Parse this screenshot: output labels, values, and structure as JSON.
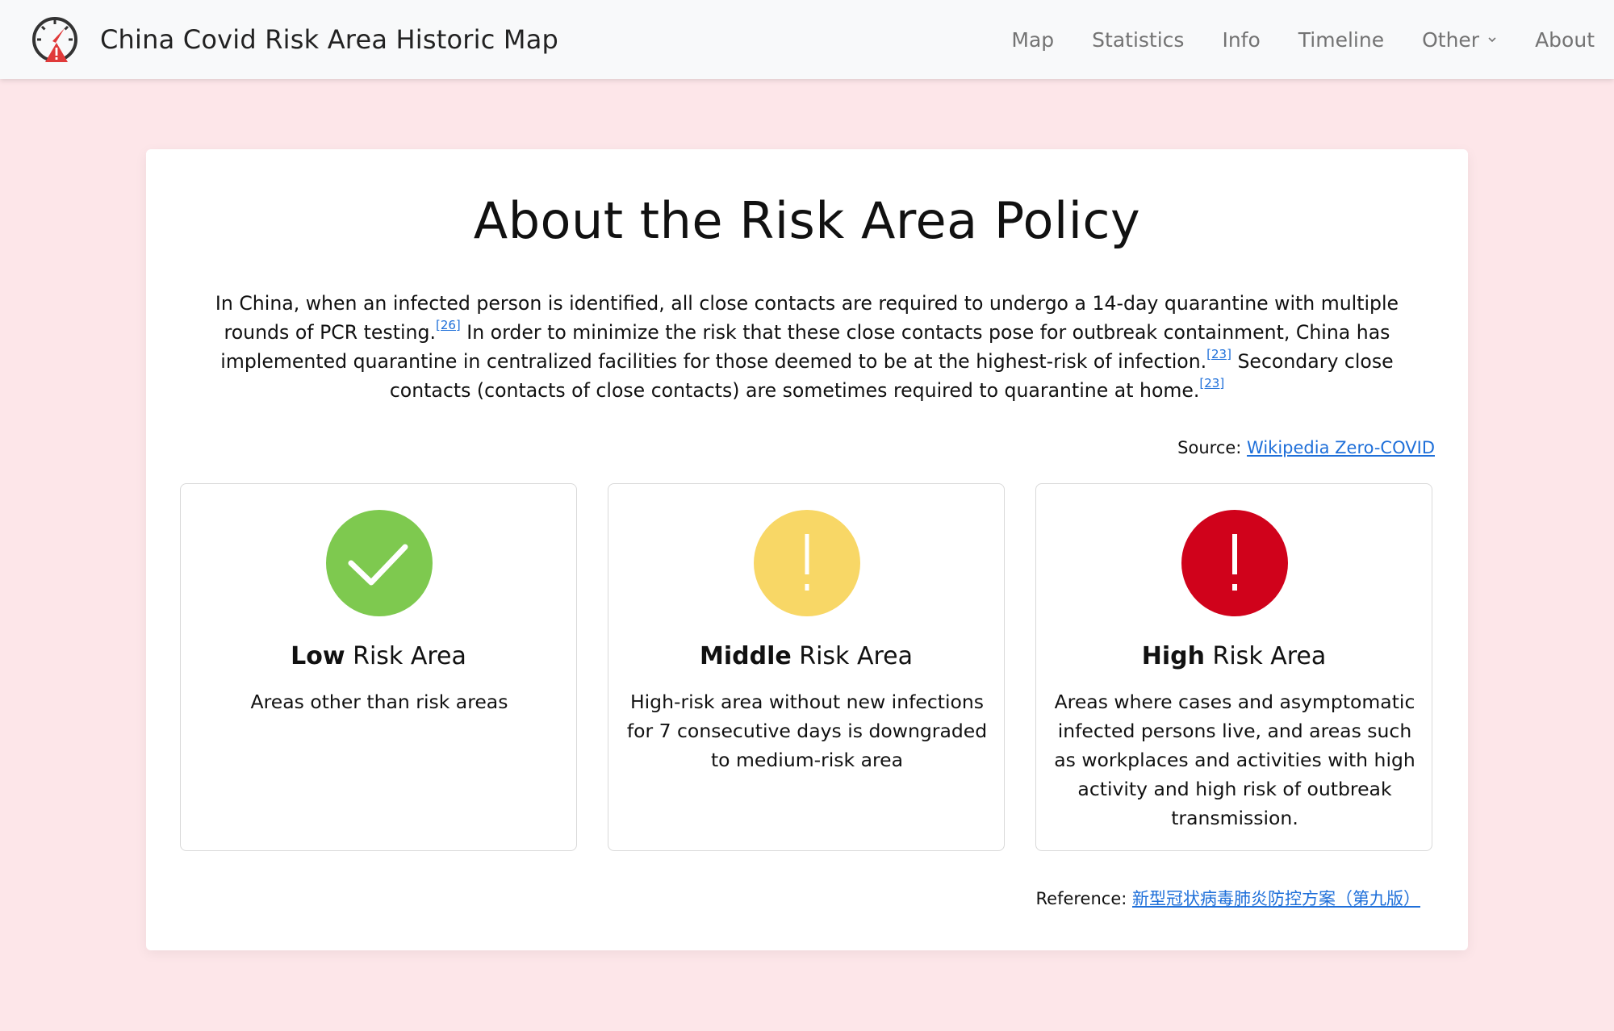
{
  "navbar": {
    "brand_title": "China Covid Risk Area Historic Map",
    "links": [
      {
        "label": "Map"
      },
      {
        "label": "Statistics"
      },
      {
        "label": "Info"
      },
      {
        "label": "Timeline"
      },
      {
        "label": "Other",
        "dropdown": true
      },
      {
        "label": "About"
      }
    ]
  },
  "main": {
    "title": "About the Risk Area Policy",
    "intro": {
      "part1": "In China, when an infected person is identified, all close contacts are required to undergo a 14-day quarantine with multiple rounds of PCR testing.",
      "cite1": "[26]",
      "part2": " In order to minimize the risk that these close contacts pose for outbreak containment, China has implemented quarantine in centralized facilities for those deemed to be at the highest-risk of infection.",
      "cite2": "[23]",
      "part3": " Secondary close contacts (contacts of close contacts) are sometimes required to quarantine at home.",
      "cite3": "[23]"
    },
    "source": {
      "label": "Source: ",
      "link_text": "Wikipedia Zero-COVID"
    },
    "tiles": [
      {
        "level": "Low",
        "suffix": " Risk Area",
        "description": "Areas other than risk areas",
        "icon": "check-icon",
        "color": "#7ec94f"
      },
      {
        "level": "Middle",
        "suffix": " Risk Area",
        "description": "High-risk area without new infections for 7 consecutive days is downgraded to medium-risk area",
        "icon": "exclamation-icon",
        "color": "#f8d766"
      },
      {
        "level": "High",
        "suffix": " Risk Area",
        "description": "Areas where cases and asymptomatic infected persons live, and areas such as workplaces and activities with high activity and high risk of outbreak transmission.",
        "icon": "exclamation-icon",
        "color": "#d0021b"
      }
    ],
    "reference": {
      "label": "Reference: ",
      "link_text": "新型冠状病毒肺炎防控方案（第九版）"
    }
  },
  "colors": {
    "page_background": "#fde6e9",
    "link": "#1e6fd9",
    "logo_red": "#e03a3a"
  }
}
